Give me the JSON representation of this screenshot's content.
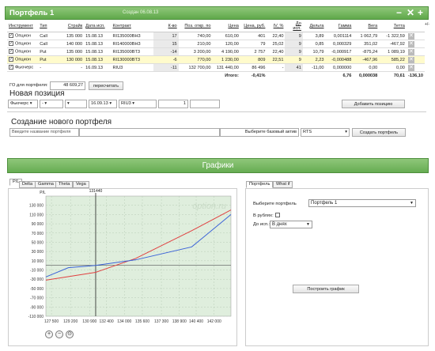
{
  "portfolio": {
    "title": "Портфель 1",
    "created": "Создан 06.08.13",
    "controls": {
      "minimize": "−",
      "close": "✕",
      "add": "+",
      "side_label": "+/-"
    },
    "columns": [
      "Инструмент",
      "Тип",
      "Страйк",
      "Дата исп.",
      "Контракт",
      "К-во",
      "Поз. откр. по",
      "Цена",
      "Цена, руб.",
      "IV, %",
      "До исп.",
      "Дельта",
      "Гамма",
      "Вега",
      "Тетта"
    ],
    "rows": [
      {
        "instrument": "Опцион",
        "type": "Call",
        "strike": "135 000",
        "date": "15.08.13",
        "contract": "RI135000BH3",
        "qty": "17",
        "open": "740,00",
        "price": "610,00",
        "price_rub": "401",
        "iv": "22,40",
        "days": "9",
        "delta": "3,89",
        "gamma": "0,001114",
        "vega": "1 062,79",
        "theta": "-1 322,59",
        "highlight": false
      },
      {
        "instrument": "Опцион",
        "type": "Call",
        "strike": "140 000",
        "date": "15.08.13",
        "contract": "RI140000BH3",
        "qty": "15",
        "open": "210,00",
        "price": "120,00",
        "price_rub": "79",
        "iv": "25,02",
        "days": "9",
        "delta": "0,85",
        "gamma": "0,000329",
        "vega": "351,02",
        "theta": "-467,92",
        "highlight": false
      },
      {
        "instrument": "Опцион",
        "type": "Put",
        "strike": "135 000",
        "date": "15.08.13",
        "contract": "RI135000BT3",
        "qty": "-14",
        "open": "3 200,00",
        "price": "4 190,00",
        "price_rub": "2 757",
        "iv": "22,40",
        "days": "9",
        "delta": "10,79",
        "gamma": "-0,000917",
        "vega": "-875,24",
        "theta": "1 089,19",
        "highlight": false
      },
      {
        "instrument": "Опцион",
        "type": "Put",
        "strike": "130 000",
        "date": "15.08.13",
        "contract": "RI130000BT3",
        "qty": "-6",
        "open": "770,00",
        "price": "1 230,00",
        "price_rub": "809",
        "iv": "22,51",
        "days": "9",
        "delta": "2,23",
        "gamma": "-0,000488",
        "vega": "-467,96",
        "theta": "585,22",
        "highlight": true
      },
      {
        "instrument": "Фьючерс",
        "type": "-",
        "strike": "-",
        "date": "16.09.13",
        "contract": "RIU3",
        "qty": "-11",
        "open": "132 700,00",
        "price": "131 440,00",
        "price_rub": "86 496",
        "iv": "-",
        "days": "41",
        "delta": "-11,00",
        "gamma": "0,000000",
        "vega": "0,00",
        "theta": "0,00",
        "highlight": false
      }
    ],
    "total": {
      "label": "Итого:",
      "pct": "-0,41%",
      "delta": "6,76",
      "gamma": "0,000038",
      "vega": "70,61",
      "theta": "-136,10"
    },
    "go_label": "ГО для портфеля:",
    "go_value": "48 609,27",
    "recalc_button": "пересчитать"
  },
  "new_position": {
    "title": "Новая позиция",
    "instrument": "Фьючерс",
    "type": "-",
    "strike": "",
    "date": "16.09.13",
    "contract": "RIU3",
    "qty": "1",
    "add_button": "Добавить позицию"
  },
  "create_portfolio": {
    "title": "Создание нового портфеля",
    "name_placeholder": "Введите название портфеля",
    "base_label": "Выберите базовый актив",
    "base_value": "RTS",
    "create_button": "Создать портфель"
  },
  "graphs": {
    "title": "Графики",
    "tabs": [
      "P/L",
      "Delta",
      "Gamma",
      "Theta",
      "Vega"
    ],
    "watermark": "option.ru",
    "marker_label": "131440",
    "ylabel": "P/L",
    "zoom_icons": [
      "zoom-in-icon",
      "zoom-out-icon",
      "zoom-reset-icon"
    ]
  },
  "chart_data": {
    "type": "line",
    "title": "",
    "xlabel": "",
    "ylabel": "P/L",
    "xlim": [
      127000,
      143500
    ],
    "ylim": [
      -110000,
      150000
    ],
    "x_ticks": [
      "127 500",
      "129 200",
      "130 900",
      "132 400",
      "134 000",
      "135 600",
      "137 300",
      "138 900",
      "140 400",
      "142 000"
    ],
    "y_ticks": [
      "130 000",
      "110 000",
      "90 000",
      "70 000",
      "50 000",
      "30 000",
      "10 000",
      "-10 000",
      "-30 000",
      "-50 000",
      "-70 000",
      "-90 000",
      "-110 000"
    ],
    "marker_x": 131440,
    "grid": true,
    "series": [
      {
        "color": "#e04040",
        "x": [
          127000,
          131440,
          135000,
          140000,
          143500
        ],
        "y": [
          -32000,
          -15000,
          15000,
          75000,
          120000
        ]
      },
      {
        "color": "#3a62d8",
        "x": [
          127000,
          129000,
          131440,
          135000,
          140000,
          143500
        ],
        "y": [
          -25000,
          -5000,
          0,
          12000,
          40000,
          110000
        ]
      }
    ]
  },
  "right_panel": {
    "tabs": [
      "Портфель",
      "What if"
    ],
    "select_label": "Выберите портфель",
    "select_value": "Портфель 1",
    "rub_label": "В рублях:",
    "until_label": "До исп.:",
    "until_value": "В днях",
    "build_button": "Построить график"
  }
}
